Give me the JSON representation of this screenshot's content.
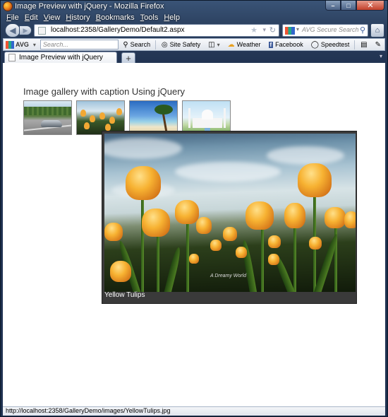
{
  "window": {
    "title": "Image Preview with jQuery - Mozilla Firefox",
    "buttons": {
      "minimize": "–",
      "maximize": "□",
      "close": "✕"
    }
  },
  "menu": {
    "items": [
      {
        "label": "File",
        "u": "F",
        "rest": "ile"
      },
      {
        "label": "Edit",
        "u": "E",
        "rest": "dit"
      },
      {
        "label": "View",
        "u": "V",
        "rest": "iew"
      },
      {
        "label": "History",
        "u": "H",
        "rest": "istory"
      },
      {
        "label": "Bookmarks",
        "u": "B",
        "rest": "ookmarks"
      },
      {
        "label": "Tools",
        "u": "T",
        "rest": "ools"
      },
      {
        "label": "Help",
        "u": "H",
        "rest": "elp"
      }
    ]
  },
  "nav": {
    "url": "localhost:2358/GalleryDemo/Default2.aspx",
    "search_placeholder": "AVG Secure Search"
  },
  "avg_toolbar": {
    "logo": "AVG",
    "search_placeholder": "Search...",
    "search_button": "Search",
    "site_safety": "Site Safety",
    "weather": "Weather",
    "facebook": "Facebook",
    "speedtest": "Speedtest"
  },
  "tabs": {
    "active_label": "Image Preview with jQuery",
    "new_tab": "+"
  },
  "page": {
    "title": "Image gallery with caption Using jQuery",
    "thumbnails": [
      {
        "name": "car"
      },
      {
        "name": "tulips"
      },
      {
        "name": "beach"
      },
      {
        "name": "taj-mahal"
      }
    ],
    "preview": {
      "caption": "Yellow Tulips",
      "watermark": "A Dreamy World"
    }
  },
  "status": {
    "text": "http://localhost:2358/GalleryDemo/images/YellowTulips.jpg"
  },
  "colors": {
    "accent": "#f7b232",
    "preview_bg": "#3a3a3a"
  }
}
